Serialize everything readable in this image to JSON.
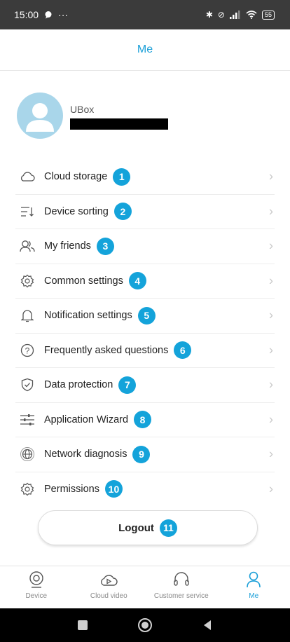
{
  "status_bar": {
    "time": "15:00",
    "left_icons": [
      "chat-bubble-icon",
      "more-dots-icon"
    ],
    "battery": "55",
    "right_icons": [
      "bluetooth-icon",
      "mute-icon",
      "signal-icon",
      "wifi-icon",
      "battery-icon"
    ]
  },
  "header": {
    "title": "Me"
  },
  "profile": {
    "name": "UBox"
  },
  "menu": [
    {
      "label": "Cloud storage",
      "badge": "1",
      "icon": "cloud-icon"
    },
    {
      "label": "Device sorting",
      "badge": "2",
      "icon": "sort-icon"
    },
    {
      "label": "My friends",
      "badge": "3",
      "icon": "friends-icon"
    },
    {
      "label": "Common settings",
      "badge": "4",
      "icon": "gear-icon"
    },
    {
      "label": "Notification settings",
      "badge": "5",
      "icon": "bell-icon"
    },
    {
      "label": "Frequently asked questions",
      "badge": "6",
      "icon": "question-icon"
    },
    {
      "label": "Data protection",
      "badge": "7",
      "icon": "shield-icon"
    },
    {
      "label": "Application Wizard",
      "badge": "8",
      "icon": "sliders-icon"
    },
    {
      "label": "Network diagnosis",
      "badge": "9",
      "icon": "globe-icon"
    },
    {
      "label": "Permissions",
      "badge": "10",
      "icon": "gear-icon"
    }
  ],
  "logout": {
    "label": "Logout",
    "badge": "11"
  },
  "tabbar": [
    {
      "label": "Device",
      "icon": "camera-icon"
    },
    {
      "label": "Cloud video",
      "icon": "cloud-play-icon"
    },
    {
      "label": "Customer service",
      "icon": "headset-icon"
    },
    {
      "label": "Me",
      "icon": "person-icon",
      "active": true
    }
  ],
  "colors": {
    "accent": "#1a9fd8",
    "badge": "#14a3da",
    "status_bar": "#3b3b3b"
  }
}
